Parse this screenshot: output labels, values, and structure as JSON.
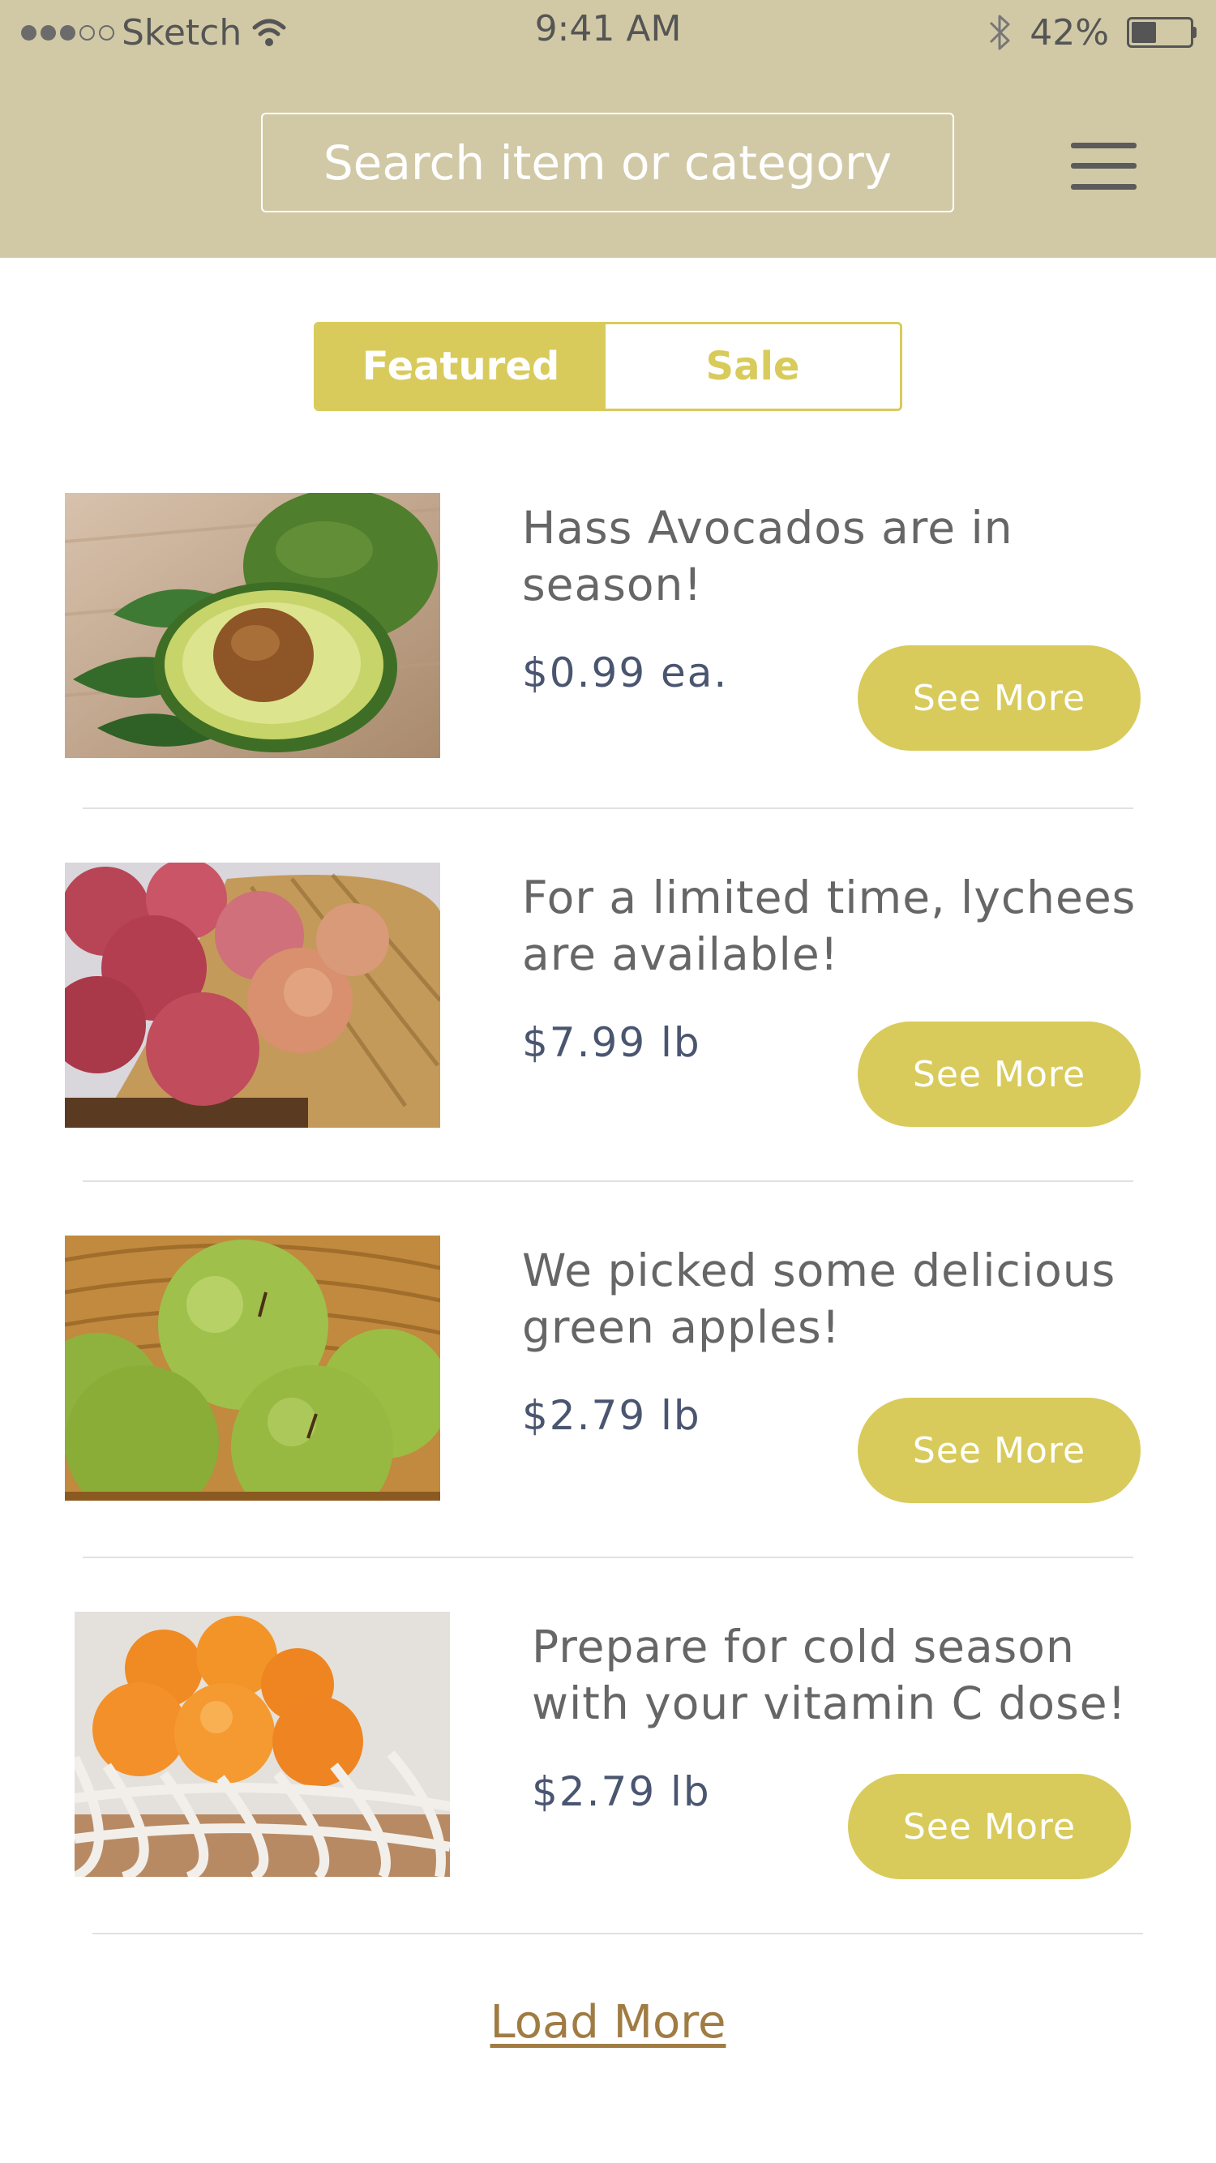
{
  "status_bar": {
    "carrier": "Sketch",
    "signal_dots_filled": 3,
    "signal_dots_total": 5,
    "time": "9:41 AM",
    "battery_percent": "42%",
    "icons": [
      "signal-dots-icon",
      "wifi-icon",
      "bluetooth-icon",
      "battery-icon"
    ]
  },
  "header": {
    "search_placeholder": "Search item or category",
    "menu_icon": "hamburger-menu-icon"
  },
  "tabs": [
    {
      "label": "Featured",
      "active": true
    },
    {
      "label": "Sale",
      "active": false
    }
  ],
  "items": [
    {
      "title": "Hass Avocados are in season!",
      "price": "$0.99 ea.",
      "button": "See More",
      "image": "avocado-photo"
    },
    {
      "title": "For a limited time, lychees are available!",
      "price": "$7.99 lb",
      "button": "See More",
      "image": "lychee-photo"
    },
    {
      "title": "We picked some delicious green apples!",
      "price": "$2.79 lb",
      "button": "See More",
      "image": "green-apple-photo"
    },
    {
      "title": "Prepare for cold season with your vitamin C dose!",
      "price": "$2.79 lb",
      "button": "See More",
      "image": "orange-photo"
    }
  ],
  "load_more": "Load More",
  "colors": {
    "header_bg": "#d1c9a6",
    "accent": "#d8cb5b",
    "link": "#a07c43",
    "title_text": "#666666",
    "price_text": "#4a5570"
  }
}
